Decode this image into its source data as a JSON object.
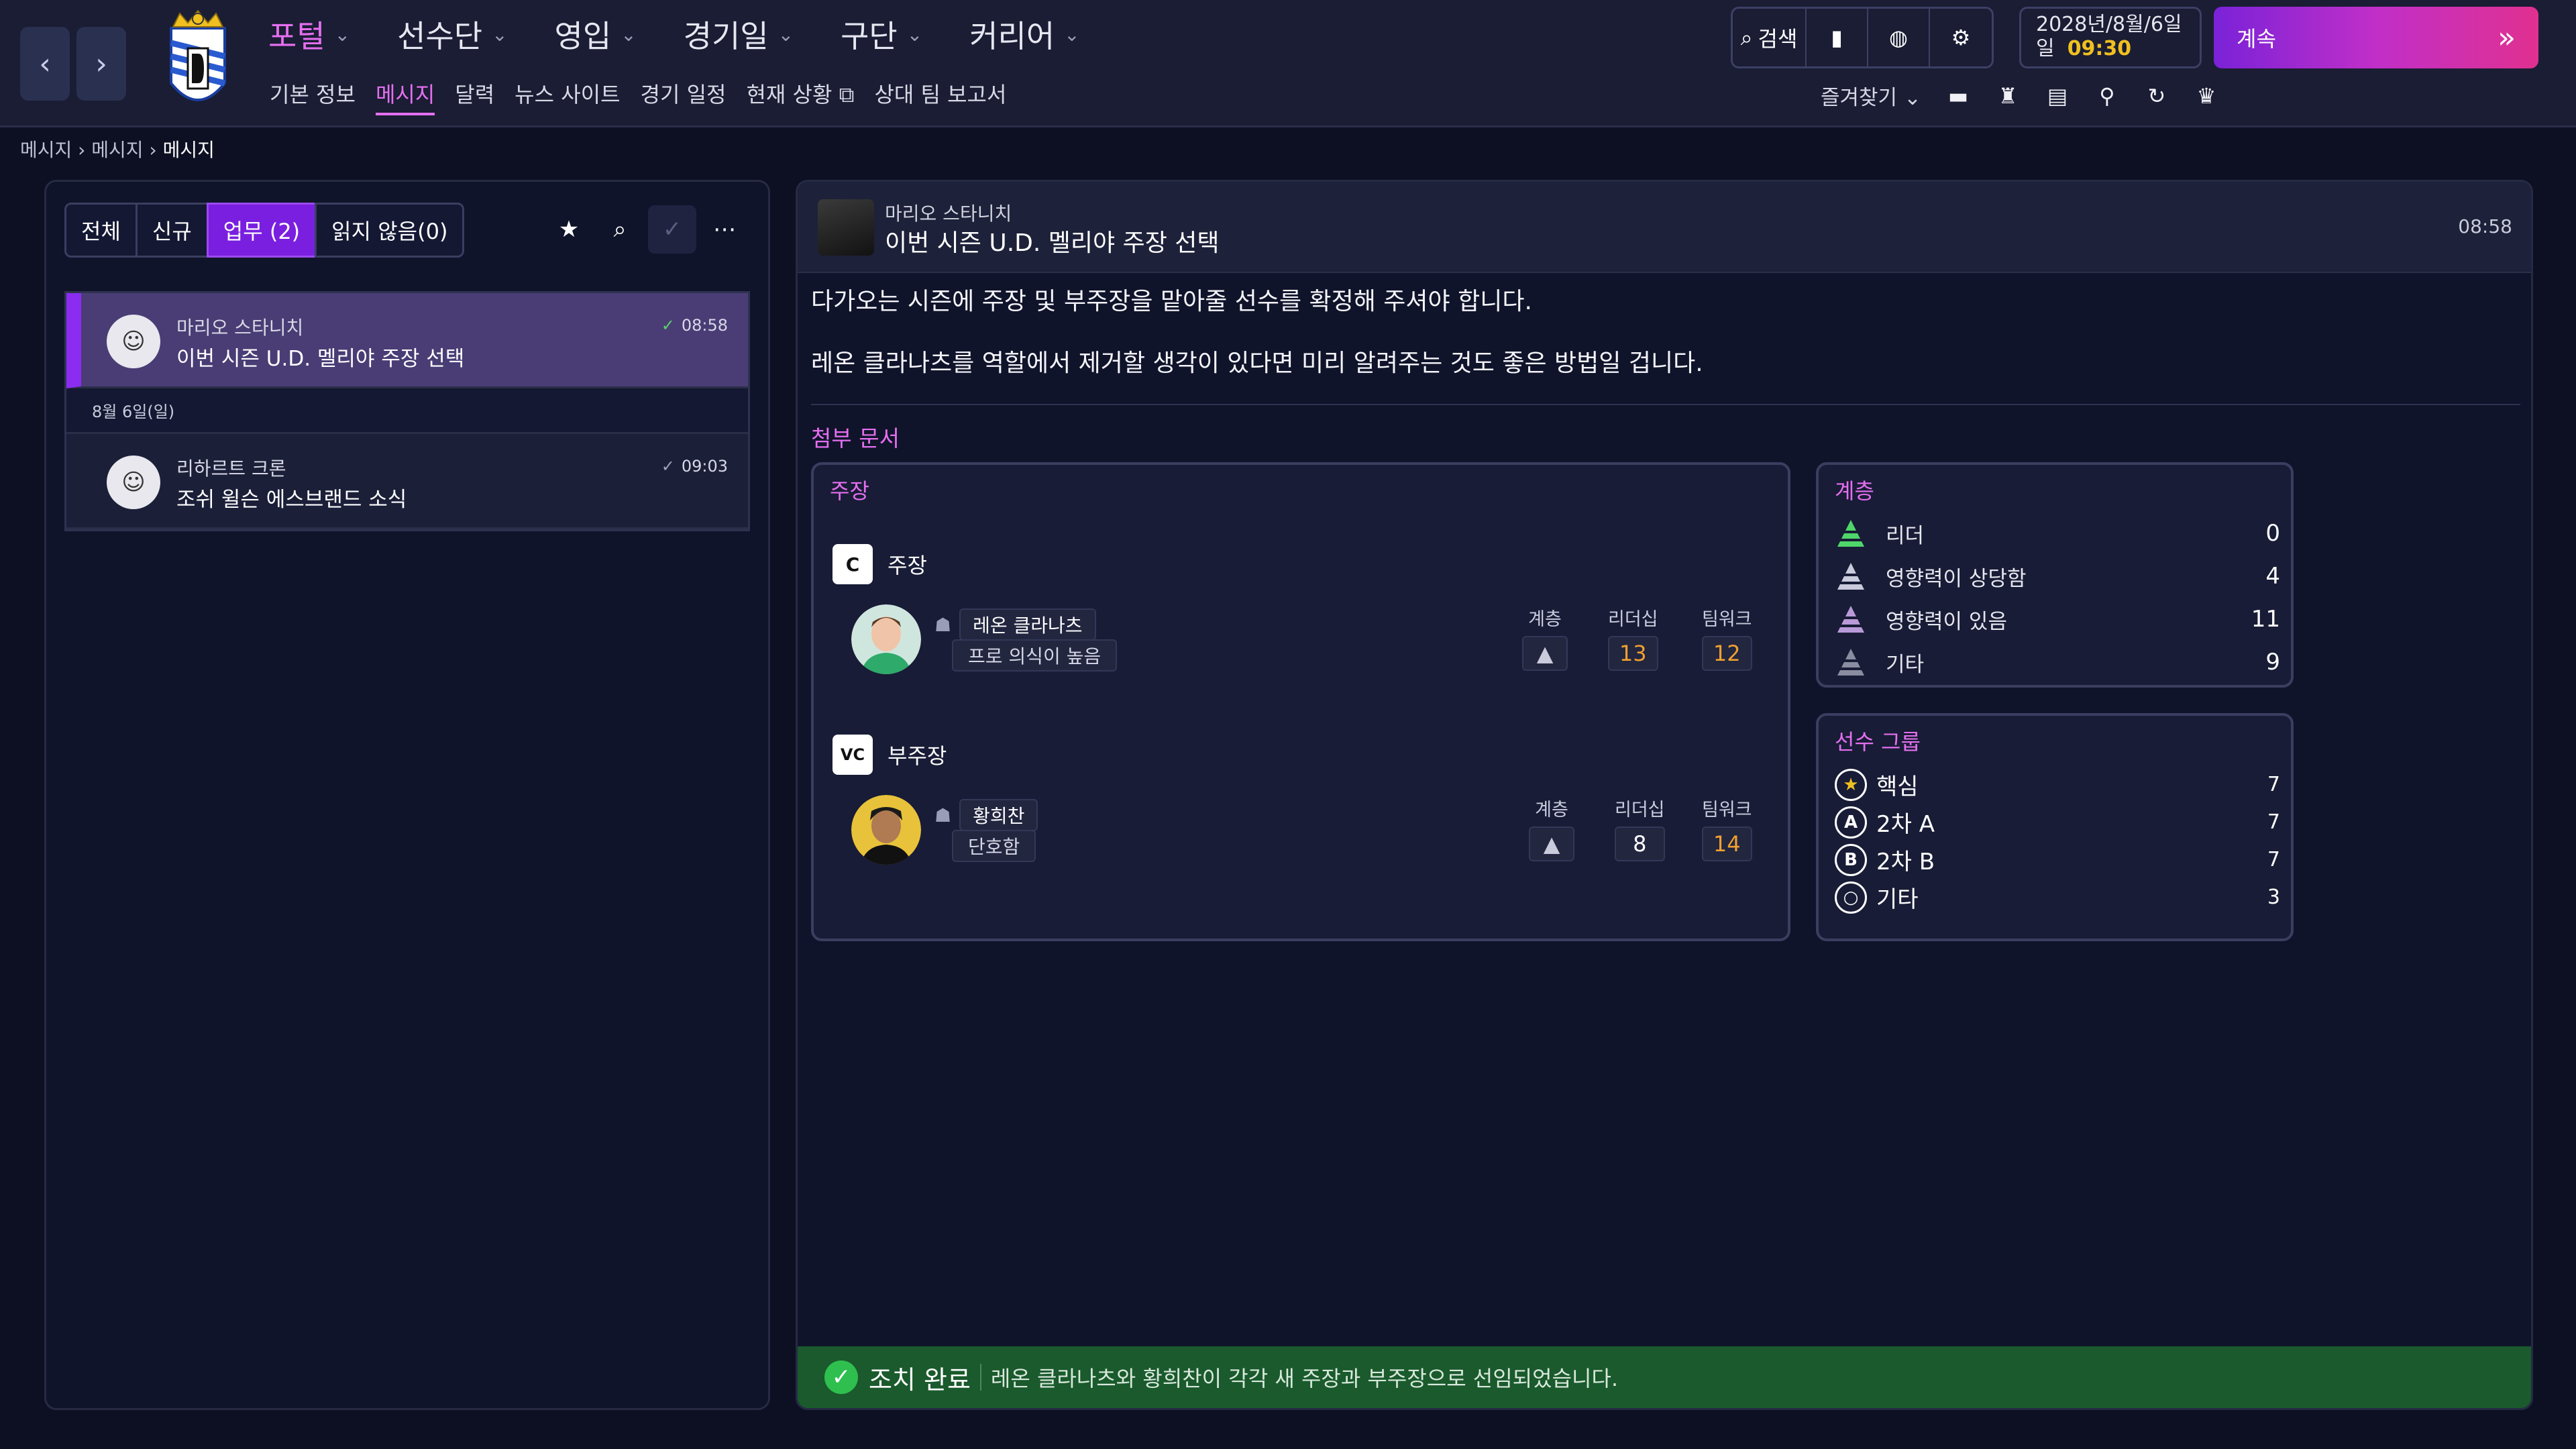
{
  "nav": {
    "back_icon": "‹",
    "forward_icon": "›",
    "main_menu": [
      {
        "label": "포털",
        "active": true
      },
      {
        "label": "선수단",
        "active": false
      },
      {
        "label": "영입",
        "active": false
      },
      {
        "label": "경기일",
        "active": false
      },
      {
        "label": "구단",
        "active": false
      },
      {
        "label": "커리어",
        "active": false
      }
    ],
    "sub_menu": [
      "기본 정보",
      "메시지",
      "달력",
      "뉴스 사이트",
      "경기 일정",
      "현재 상황",
      "상대 팀 보고서"
    ],
    "search_label": "검색",
    "date": "2028년/8월/6일",
    "day": "일",
    "time": "09:30",
    "continue_label": "계속",
    "favorites_label": "즐겨찾기"
  },
  "breadcrumb": [
    "메시지",
    "메시지",
    "메시지"
  ],
  "filters": [
    "전체",
    "신규",
    "업무 (2)",
    "읽지 않음(0)"
  ],
  "messages": [
    {
      "sender": "마리오 스타니치",
      "subject": "이번 시즌 U.D. 멜리야 주장 선택",
      "time": "08:58"
    },
    {
      "sender": "리하르트 크론",
      "subject": "조쉬 윌슨 에스브랜드 소식",
      "time": "09:03"
    }
  ],
  "date_group": "8월 6일(일)",
  "detail": {
    "sender": "마리오 스타니치",
    "subject": "이번 시즌 U.D. 멜리야 주장 선택",
    "time": "08:58",
    "paragraph1": "다가오는 시즌에 주장 및 부주장을 맡아줄 선수를 확정해 주셔야 합니다.",
    "paragraph2": "레온 클라나츠를 역할에서 제거할 생각이 있다면 미리 알려주는 것도 좋은 방법일 겁니다.",
    "attachments_label": "첨부 문서"
  },
  "captains": {
    "title": "주장",
    "captain": {
      "role": "주장",
      "badge": "C",
      "name": "레온 클라나츠",
      "trait": "프로 의식이 높음",
      "tier_label": "계층",
      "leadership_label": "리더십",
      "teamwork_label": "팀워크",
      "leadership": "13",
      "teamwork": "12"
    },
    "vice": {
      "role": "부주장",
      "badge": "VC",
      "name": "황희찬",
      "trait": "단호함",
      "tier_label": "계층",
      "leadership_label": "리더십",
      "teamwork_label": "팀워크",
      "leadership": "8",
      "teamwork": "14"
    }
  },
  "tiers": {
    "title": "계층",
    "rows": [
      {
        "label": "리더",
        "count": "0",
        "color": "#4fd66a"
      },
      {
        "label": "영향력이 상당함",
        "count": "4",
        "color": "#c9cbdc"
      },
      {
        "label": "영향력이 있음",
        "count": "11",
        "color": "#b99ad8"
      },
      {
        "label": "기타",
        "count": "9",
        "color": "#8a8ca0"
      }
    ]
  },
  "groups": {
    "title": "선수 그룹",
    "rows": [
      {
        "label": "핵심",
        "count": "7",
        "icon": "★"
      },
      {
        "label": "2차 A",
        "count": "7",
        "icon": "A"
      },
      {
        "label": "2차 B",
        "count": "7",
        "icon": "B"
      },
      {
        "label": "기타",
        "count": "3",
        "icon": "○"
      }
    ]
  },
  "status": {
    "title": "조치 완료",
    "text": "레온 클라나츠와 황희찬이 각각 새 주장과 부주장으로 선임되었습니다."
  }
}
